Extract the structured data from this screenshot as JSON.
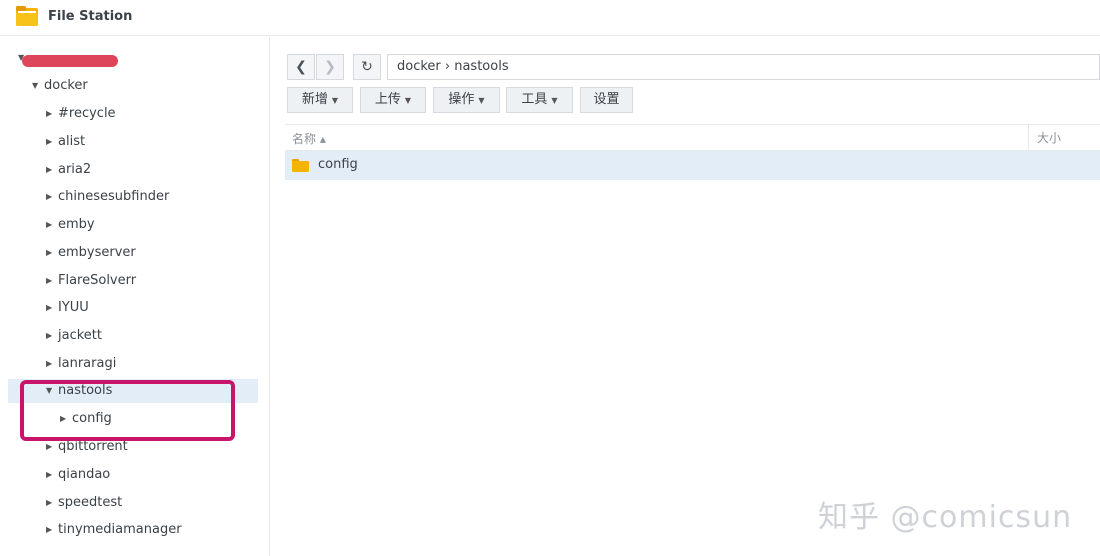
{
  "app": {
    "title": "File Station",
    "icon": "folder-icon",
    "accent": "#f5b400"
  },
  "sidebar": {
    "root": {
      "label": ""
    },
    "items": [
      {
        "label": "docker",
        "level": 1,
        "expanded": true
      },
      {
        "label": "#recycle",
        "level": 2
      },
      {
        "label": "alist",
        "level": 2
      },
      {
        "label": "aria2",
        "level": 2
      },
      {
        "label": "chinesesubfinder",
        "level": 2
      },
      {
        "label": "emby",
        "level": 2
      },
      {
        "label": "embyserver",
        "level": 2
      },
      {
        "label": "FlareSolverr",
        "level": 2
      },
      {
        "label": "IYUU",
        "level": 2
      },
      {
        "label": "jackett",
        "level": 2
      },
      {
        "label": "lanraragi",
        "level": 2
      },
      {
        "label": "nastools",
        "level": 2,
        "expanded": true,
        "selected": true
      },
      {
        "label": "config",
        "level": 3
      },
      {
        "label": "qbittorrent",
        "level": 2
      },
      {
        "label": "qiandao",
        "level": 2
      },
      {
        "label": "speedtest",
        "level": 2
      },
      {
        "label": "tinymediamanager",
        "level": 2
      }
    ],
    "highlight_color": "#c8156b"
  },
  "toolbar": {
    "back_icon": "chevron-left-icon",
    "forward_icon": "chevron-right-icon",
    "refresh_icon": "refresh-icon",
    "path": "docker › nastools",
    "buttons": [
      {
        "label": "新增",
        "dropdown": true
      },
      {
        "label": "上传",
        "dropdown": true
      },
      {
        "label": "操作",
        "dropdown": true
      },
      {
        "label": "工具",
        "dropdown": true
      },
      {
        "label": "设置",
        "dropdown": false
      }
    ]
  },
  "list": {
    "columns": {
      "name": "名称 ▴",
      "size": "大小"
    },
    "rows": [
      {
        "name": "config",
        "icon": "folder-icon"
      }
    ],
    "row_highlight": "#e3edf8"
  },
  "watermark": "知乎 @comicsun"
}
